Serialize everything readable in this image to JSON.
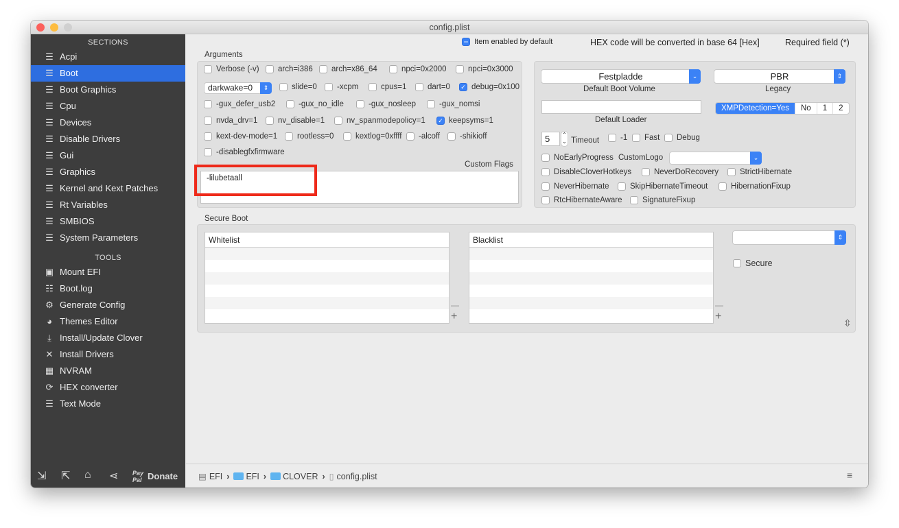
{
  "window": {
    "title": "config.plist"
  },
  "sidebar": {
    "sections_header": "SECTIONS",
    "sections": [
      "Acpi",
      "Boot",
      "Boot Graphics",
      "Cpu",
      "Devices",
      "Disable Drivers",
      "Gui",
      "Graphics",
      "Kernel and Kext Patches",
      "Rt Variables",
      "SMBIOS",
      "System Parameters"
    ],
    "selected": "Boot",
    "tools_header": "TOOLS",
    "tools": [
      {
        "label": "Mount EFI",
        "icon": "disk-icon"
      },
      {
        "label": "Boot.log",
        "icon": "log-search-icon"
      },
      {
        "label": "Generate Config",
        "icon": "gears-icon"
      },
      {
        "label": "Themes Editor",
        "icon": "palette-icon"
      },
      {
        "label": "Install/Update Clover",
        "icon": "download-icon"
      },
      {
        "label": "Install Drivers",
        "icon": "tools-icon"
      },
      {
        "label": "NVRAM",
        "icon": "chip-icon"
      },
      {
        "label": "HEX converter",
        "icon": "refresh-icon"
      },
      {
        "label": "Text Mode",
        "icon": "text-icon"
      }
    ],
    "paypal": "Pay Pal",
    "donate": "Donate"
  },
  "header": {
    "legend": "Item enabled by default",
    "hex_note": "HEX code will be converted in base 64 [Hex]",
    "required": "Required field (*)"
  },
  "arguments": {
    "title": "Arguments",
    "darkwake": "darkwake=0",
    "rows": [
      [
        {
          "label": "Verbose (-v)",
          "checked": false
        },
        {
          "label": "arch=i386",
          "checked": false
        },
        {
          "label": "arch=x86_64",
          "checked": false
        },
        {
          "label": "npci=0x2000",
          "checked": false
        },
        {
          "label": "npci=0x3000",
          "checked": false
        }
      ],
      [
        {
          "label": "slide=0",
          "checked": false
        },
        {
          "label": "-xcpm",
          "checked": false
        },
        {
          "label": "cpus=1",
          "checked": false
        },
        {
          "label": "dart=0",
          "checked": false
        },
        {
          "label": "debug=0x100",
          "checked": true
        }
      ],
      [
        {
          "label": "-gux_defer_usb2",
          "checked": false
        },
        {
          "label": "-gux_no_idle",
          "checked": false
        },
        {
          "label": "-gux_nosleep",
          "checked": false
        },
        {
          "label": "-gux_nomsi",
          "checked": false
        }
      ],
      [
        {
          "label": "nvda_drv=1",
          "checked": false
        },
        {
          "label": "nv_disable=1",
          "checked": false
        },
        {
          "label": "nv_spanmodepolicy=1",
          "checked": false
        },
        {
          "label": "keepsyms=1",
          "checked": true
        }
      ],
      [
        {
          "label": "kext-dev-mode=1",
          "checked": false
        },
        {
          "label": "rootless=0",
          "checked": false
        },
        {
          "label": "kextlog=0xffff",
          "checked": false
        },
        {
          "label": "-alcoff",
          "checked": false
        },
        {
          "label": "-shikioff",
          "checked": false
        }
      ],
      [
        {
          "label": "-disablegfxfirmware",
          "checked": false
        }
      ]
    ],
    "custom_flags_label": "Custom Flags",
    "custom_flags": "-lilubetaall"
  },
  "boot": {
    "default_volume": "Festpladde",
    "default_volume_label": "Default Boot Volume",
    "legacy": "PBR",
    "legacy_label": "Legacy",
    "default_loader": "",
    "default_loader_label": "Default Loader",
    "xmp": [
      "XMPDetection=Yes",
      "No",
      "1",
      "2"
    ],
    "xmp_selected": "XMPDetection=Yes",
    "timeout": "5",
    "timeout_label": "Timeout",
    "timeout_opts": [
      {
        "label": "-1",
        "checked": false
      },
      {
        "label": "Fast",
        "checked": false
      },
      {
        "label": "Debug",
        "checked": false
      }
    ],
    "no_early_progress": "NoEarlyProgress",
    "custom_logo_label": "CustomLogo",
    "custom_logo": "",
    "flags": [
      [
        {
          "label": "DisableCloverHotkeys",
          "checked": false
        },
        {
          "label": "NeverDoRecovery",
          "checked": false
        },
        {
          "label": "StrictHibernate",
          "checked": false
        }
      ],
      [
        {
          "label": "NeverHibernate",
          "checked": false
        },
        {
          "label": "SkipHibernateTimeout",
          "checked": false
        },
        {
          "label": "HibernationFixup",
          "checked": false
        }
      ],
      [
        {
          "label": "RtcHibernateAware",
          "checked": false
        },
        {
          "label": "SignatureFixup",
          "checked": false
        }
      ]
    ]
  },
  "secure_boot": {
    "title": "Secure Boot",
    "whitelist": "Whitelist",
    "blacklist": "Blacklist",
    "policy": "",
    "secure_label": "Secure"
  },
  "path": [
    "EFI",
    "EFI",
    "CLOVER",
    "config.plist"
  ],
  "colors": {
    "accent": "#3b82f6",
    "sidebar": "#3d3d3d",
    "selected": "#2e6ee0",
    "highlight": "#ee2a1a"
  }
}
